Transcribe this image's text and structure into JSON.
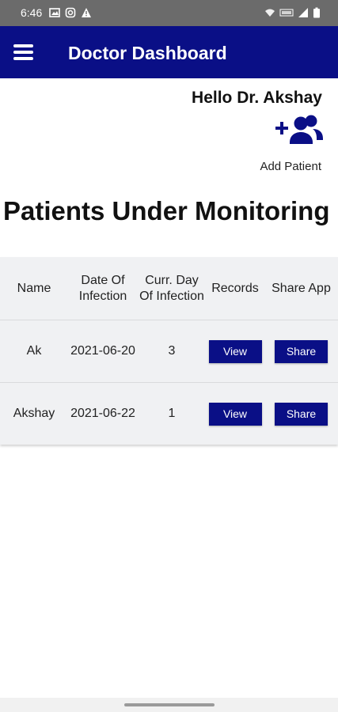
{
  "status_bar": {
    "time": "6:46",
    "left_icons": [
      "image-icon",
      "instagram-icon",
      "warning-icon"
    ],
    "right_icons": [
      "wifi-icon",
      "volte-icon",
      "signal-icon",
      "battery-icon"
    ]
  },
  "app_bar": {
    "title": "Doctor Dashboard",
    "menu_icon": "menu-icon",
    "background_color": "#0a0f86"
  },
  "greeting": "Hello Dr. Akshay",
  "add_patient": {
    "icon": "add-group-icon",
    "label": "Add Patient"
  },
  "section_title": "Patients Under Monitoring",
  "table": {
    "headers": [
      "Name",
      "Date Of Infection",
      "Curr. Day Of Infection",
      "Records",
      "Share App"
    ],
    "rows": [
      {
        "name": "Ak",
        "date_of_infection": "2021-06-20",
        "current_day": "3",
        "records_button": "View",
        "share_button": "Share"
      },
      {
        "name": "Akshay",
        "date_of_infection": "2021-06-22",
        "current_day": "1",
        "records_button": "View",
        "share_button": "Share"
      }
    ]
  },
  "accent_color": "#0a0f86"
}
